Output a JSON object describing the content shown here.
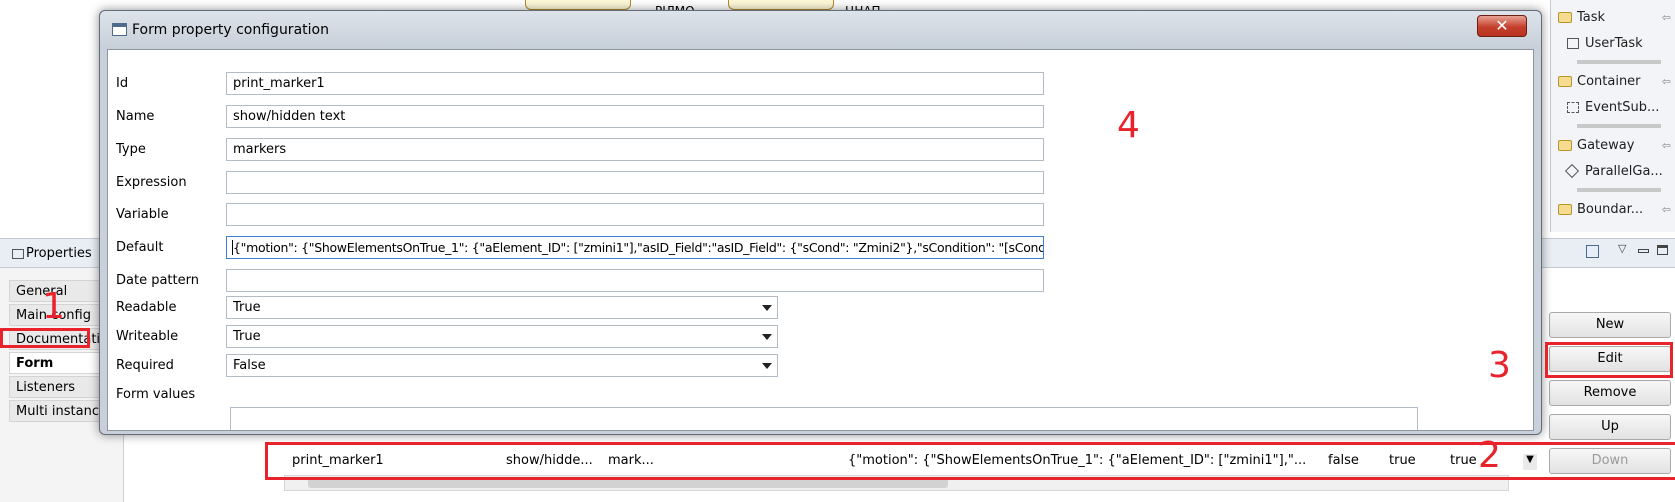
{
  "canvas": {
    "labels": [
      "РІЛМО",
      "ЦНАП"
    ]
  },
  "palette": {
    "groups": [
      {
        "label": "Task",
        "item": "UserTask"
      },
      {
        "label": "Container",
        "item": "EventSub..."
      },
      {
        "label": "Gateway",
        "item": "ParallelGa..."
      },
      {
        "label": "Boundar..."
      }
    ]
  },
  "properties": {
    "title": "Properties",
    "tabs": [
      "General",
      "Main config",
      "Documentation",
      "Form",
      "Listeners",
      "Multi instance"
    ],
    "active_tab": "Form",
    "buttons": {
      "new": "New",
      "edit": "Edit",
      "remove": "Remove",
      "up": "Up",
      "down": "Down"
    },
    "rows": [
      {
        "id": "print_marker1",
        "name": "show/hidde...",
        "type": "mark...",
        "default": "{\"motion\": {\"ShowElementsOnTrue_1\": {\"aElement_ID\": [\"zmini1\"],\"...",
        "readable": "false",
        "writeable": "true",
        "required": "true"
      }
    ]
  },
  "dialog": {
    "title": "Form property configuration",
    "close_glyph": "✕",
    "fields": {
      "id": {
        "label": "Id",
        "value": "print_marker1"
      },
      "name": {
        "label": "Name",
        "value": "show/hidden text"
      },
      "type": {
        "label": "Type",
        "value": "markers"
      },
      "expression": {
        "label": "Expression",
        "value": ""
      },
      "variable": {
        "label": "Variable",
        "value": ""
      },
      "default": {
        "label": "Default",
        "value": "{\"motion\": {\"ShowElementsOnTrue_1\": {\"aElement_ID\": [\"zmini1\"],\"asID_Field\":\"asID_Field\": {\"sCond\": \"Zmini2\"},\"sCondition\": \"[sCond]=='ok'\"}}}"
      },
      "date_pattern": {
        "label": "Date pattern",
        "value": ""
      },
      "readable": {
        "label": "Readable",
        "value": "True"
      },
      "writeable": {
        "label": "Writeable",
        "value": "True"
      },
      "required": {
        "label": "Required",
        "value": "False"
      },
      "form_values": {
        "label": "Form values"
      }
    }
  },
  "annotations": {
    "n1": "1",
    "n2": "2",
    "n3": "3",
    "n4": "4",
    "color": "#e8232b"
  }
}
